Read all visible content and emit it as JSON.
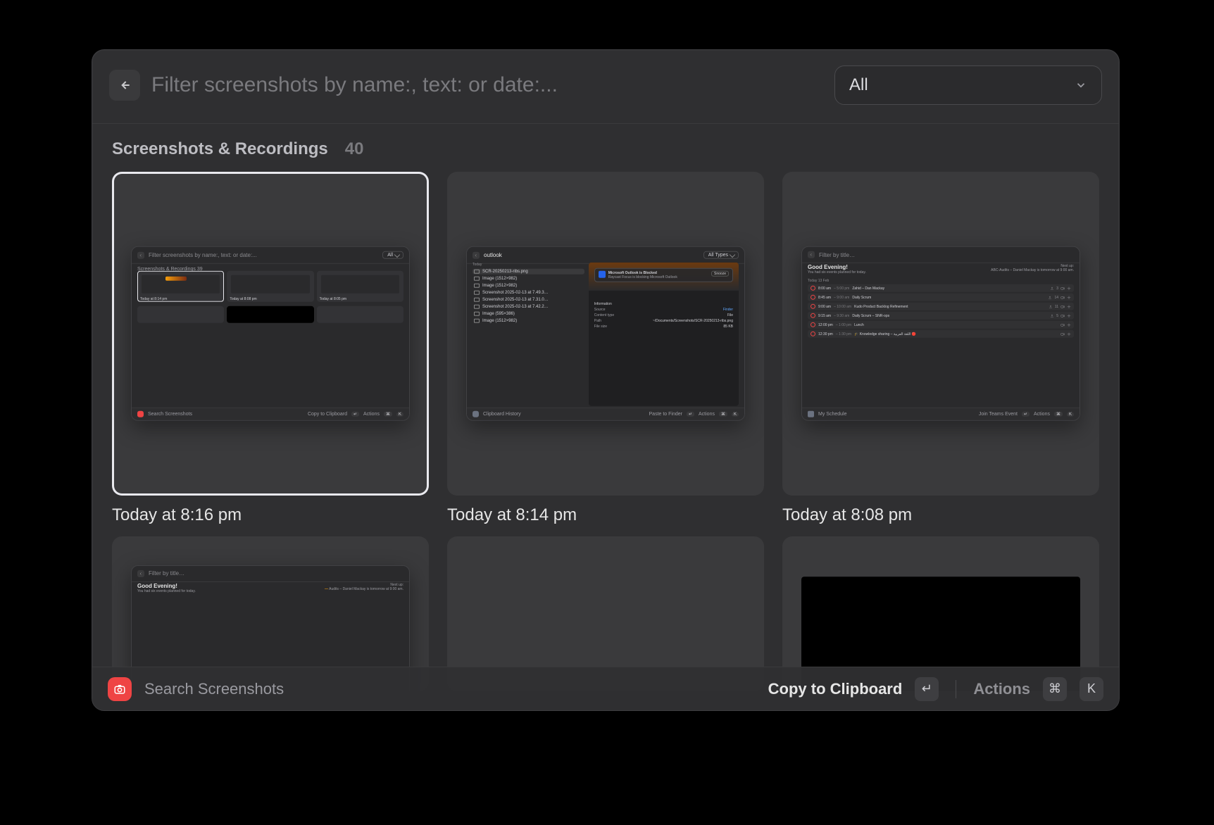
{
  "header": {
    "search_placeholder": "Filter screenshots by name:, text: or date:...",
    "type_filter": "All"
  },
  "section": {
    "title": "Screenshots & Recordings",
    "count": "40"
  },
  "items": [
    {
      "caption": "Today at 8:16 pm"
    },
    {
      "caption": "Today at 8:14 pm"
    },
    {
      "caption": "Today at 8:08 pm"
    }
  ],
  "preview1": {
    "search": "Filter screenshots by name:, text: or date:...",
    "type": "All",
    "title": "Screenshots & Recordings   39",
    "captions": [
      "Today at 8:14 pm",
      "Today at 8:08 pm",
      "Today at 8:05 pm"
    ],
    "footer_left": "Search Screenshots",
    "footer_primary": "Copy to Clipboard",
    "footer_actions": "Actions"
  },
  "preview2": {
    "search": "outlook",
    "type": "All Types",
    "section": "Today",
    "rows": [
      "SCR-20250213-ribs.png",
      "Image (1512×982)",
      "Image (1512×982)",
      "Screenshot 2025-02-13 at 7.49.3…",
      "Screenshot 2025-02-13 at 7.31.0…",
      "Screenshot 2025-02-13 at 7.42.2…",
      "Image (595×386)",
      "Image (1512×982)"
    ],
    "toast_title": "Microsoft Outlook is Blocked",
    "toast_body": "Raycast Focus is blocking Microsoft Outlook",
    "snooze": "Snooze",
    "info_header": "Information",
    "info": {
      "Source": "Finder",
      "Content type": "File",
      "Path": "~/Documents/Screenshots/SCR-20250213-ribs.png",
      "File size": "85 KB"
    },
    "footer_left": "Clipboard History",
    "footer_primary": "Paste to Finder",
    "footer_actions": "Actions"
  },
  "preview3": {
    "search": "Filter by title…",
    "greeting": "Good Evening!",
    "subtitle": "You had six events planned for today.",
    "next_label": "Next up:",
    "next_value": "ABC‑Audits – Daniel Mackay is tomorrow at 9:00 am.",
    "date_label": "Today   13 Feb",
    "events": [
      {
        "t": "8:00 am",
        "d": "5:00 pm",
        "title": "Zahid – Dan Mackay",
        "people": "3"
      },
      {
        "t": "8:45 am",
        "d": "9:00 am",
        "title": "Daily Scrum",
        "people": "14"
      },
      {
        "t": "9:00 am",
        "d": "10:00 am",
        "title": "Kudo Product Backlog Refinement",
        "people": "11"
      },
      {
        "t": "9:15 am",
        "d": "9:30 am",
        "title": "Daily Scrum – SNR‑ops",
        "people": "5"
      },
      {
        "t": "12:00 pm",
        "d": "1:00 pm",
        "title": "Lunch",
        "people": ""
      },
      {
        "t": "12:30 pm",
        "d": "1:30 pm",
        "title": "🎓 Knowledge sharing – اللغة العربية 🔴",
        "people": ""
      }
    ],
    "footer_left": "My Schedule",
    "footer_primary": "Join Teams Event",
    "footer_actions": "Actions"
  },
  "preview4": {
    "search": "Filter by title…",
    "greeting": "Good Evening!",
    "subtitle": "You had six events planned for today.",
    "next_label": "Next up:",
    "next_value": "Audits – Daniel Mackay is tomorrow at 9:00 am."
  },
  "footer": {
    "command_name": "Search Screenshots",
    "primary_action": "Copy to Clipboard",
    "enter_key": "↵",
    "actions_label": "Actions",
    "cmd_key": "⌘",
    "k_key": "K"
  }
}
